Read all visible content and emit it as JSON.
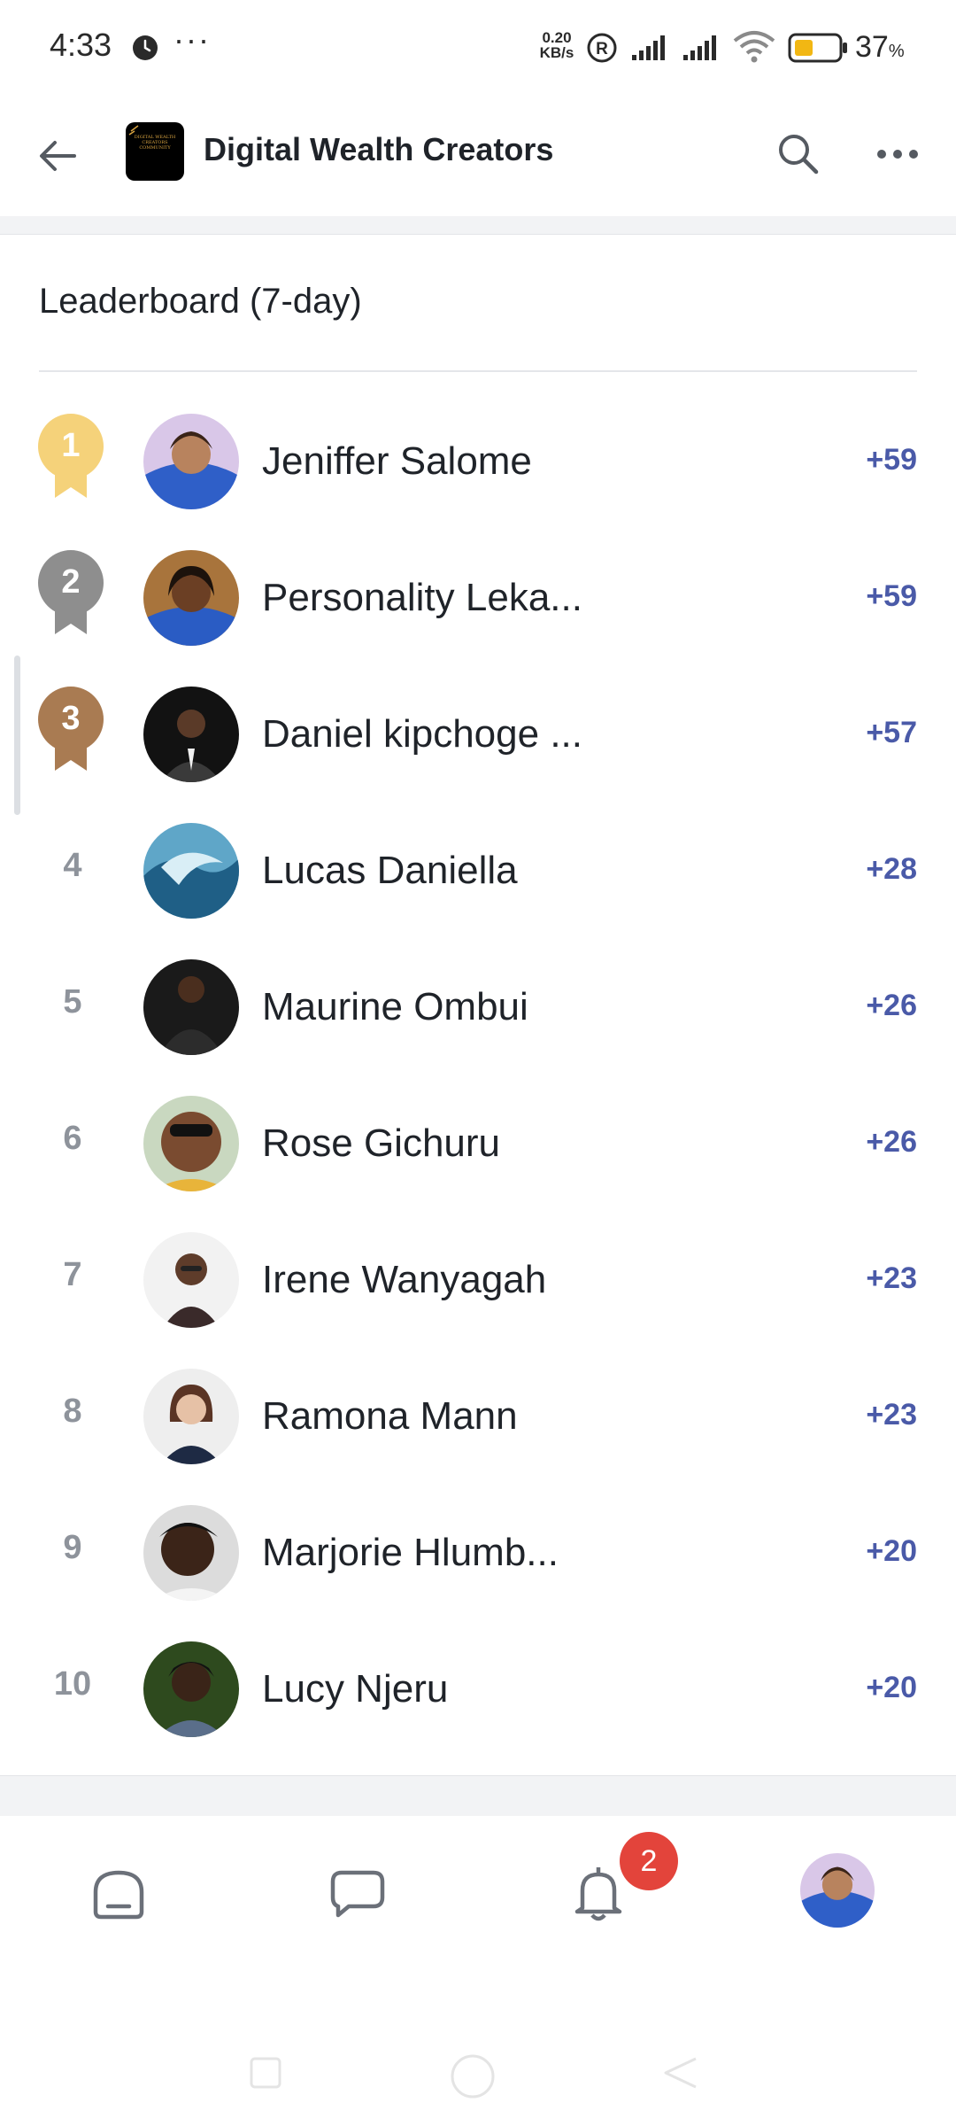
{
  "status_bar": {
    "time": "4:33",
    "speed_value": "0.20",
    "speed_unit": "KB/s",
    "battery_value": "37",
    "battery_unit": "%"
  },
  "header": {
    "group_name": "Digital Wealth Creators",
    "logo_text": "DIGITAL WEALTH CREATORS COMMUNITY"
  },
  "leaderboard": {
    "title": "Leaderboard (7-day)",
    "entries": [
      {
        "rank": "1",
        "name": "Jeniffer Salome",
        "points": "+59"
      },
      {
        "rank": "2",
        "name": "Personality Leka...",
        "points": "+59"
      },
      {
        "rank": "3",
        "name": "Daniel kipchoge ...",
        "points": "+57"
      },
      {
        "rank": "4",
        "name": "Lucas Daniella",
        "points": "+28"
      },
      {
        "rank": "5",
        "name": "Maurine Ombui",
        "points": "+26"
      },
      {
        "rank": "6",
        "name": "Rose Gichuru",
        "points": "+26"
      },
      {
        "rank": "7",
        "name": "Irene Wanyagah",
        "points": "+23"
      },
      {
        "rank": "8",
        "name": "Ramona Mann",
        "points": "+23"
      },
      {
        "rank": "9",
        "name": "Marjorie Hlumb...",
        "points": "+20"
      },
      {
        "rank": "10",
        "name": "Lucy Njeru",
        "points": "+20"
      }
    ]
  },
  "bottom_nav": {
    "notification_count": "2"
  },
  "colors": {
    "gold": "#f5d27a",
    "silver": "#8e8e8e",
    "bronze": "#a97b52",
    "points": "#4a5aa8",
    "badge": "#e3443b"
  }
}
